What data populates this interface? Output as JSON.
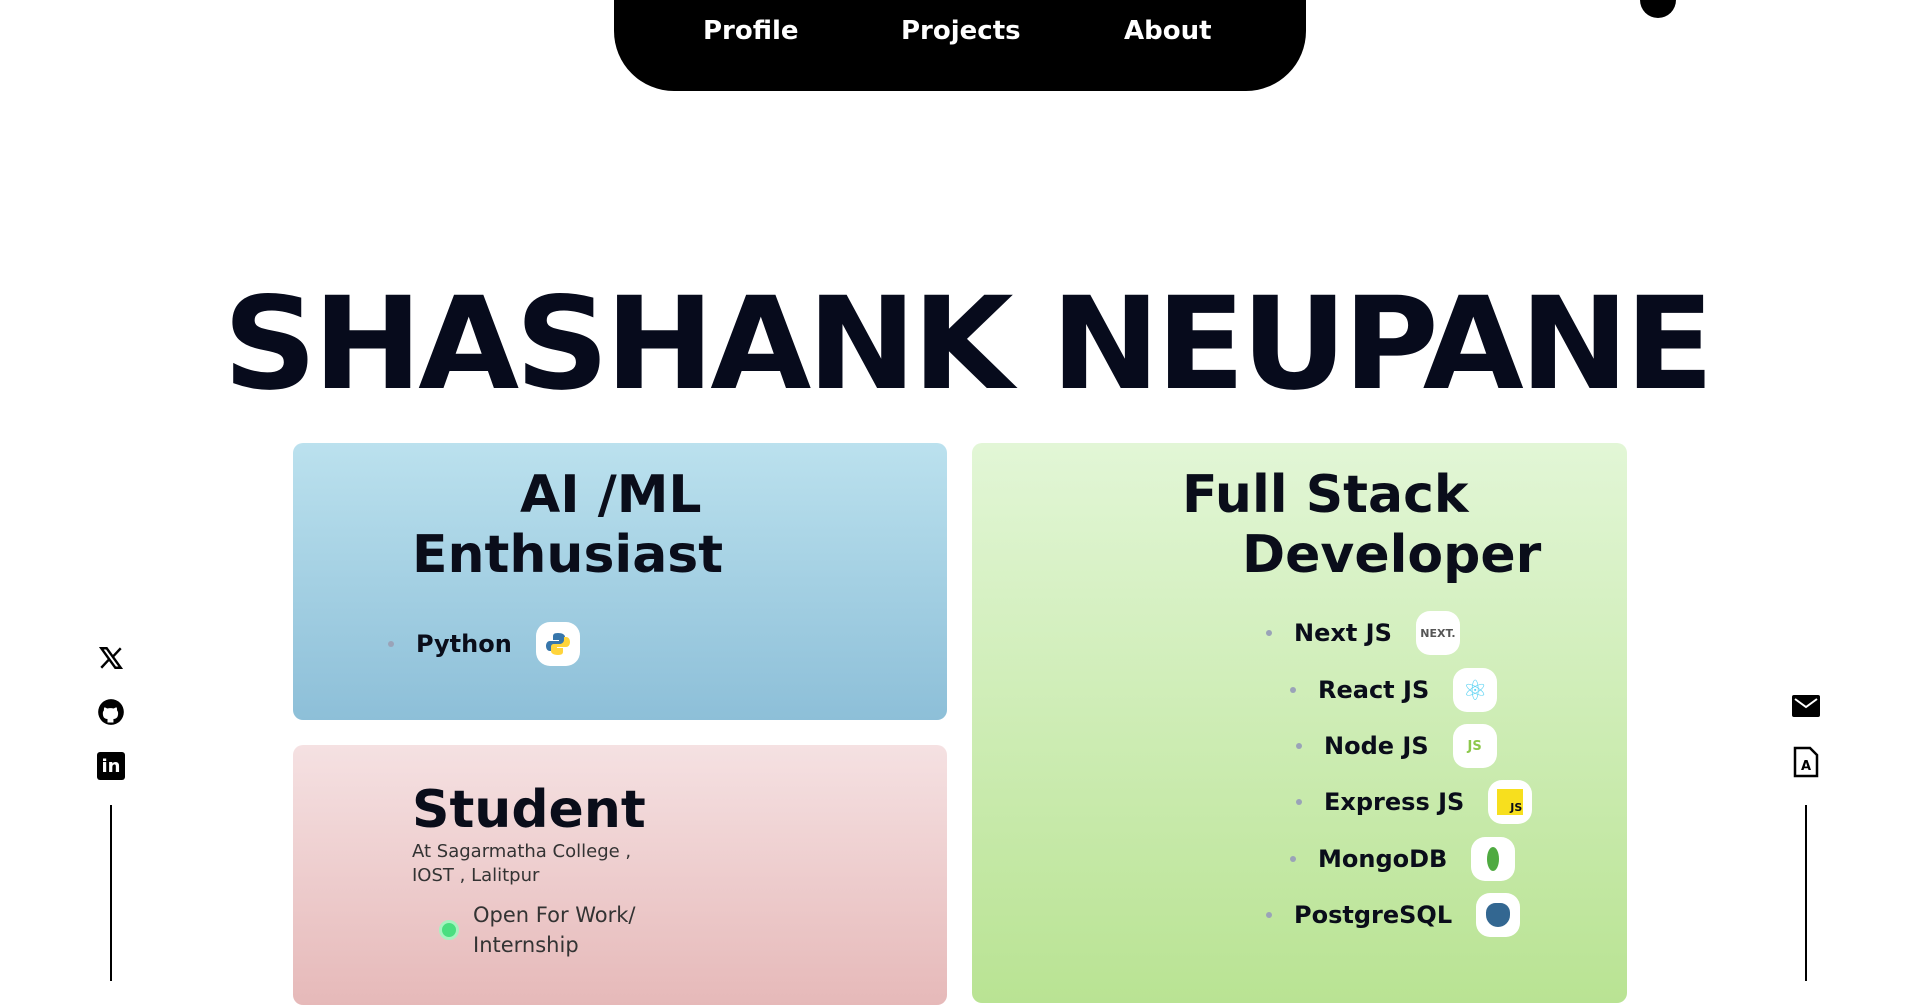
{
  "nav": {
    "items": [
      "Profile",
      "Projects",
      "About"
    ]
  },
  "hero": {
    "name": "SHASHANK NEUPANE"
  },
  "ai_card": {
    "title_line1": "AI /ML",
    "title_line2": "Enthusiast",
    "skills": [
      {
        "label": "Python",
        "icon": "python-icon"
      }
    ]
  },
  "student_card": {
    "title": "Student",
    "subtitle_line1": "At Sagarmatha College ,",
    "subtitle_line2": "IOST , Lalitpur",
    "status_line1": "Open For Work/",
    "status_line2": "Internship",
    "status_color": "#4ade80"
  },
  "fullstack_card": {
    "title_line1": "Full Stack",
    "title_line2": "Developer",
    "skills": [
      {
        "label": "Next JS",
        "icon": "nextjs-icon",
        "icon_text": "NEXT."
      },
      {
        "label": "React JS",
        "icon": "react-icon",
        "icon_text": "⚛"
      },
      {
        "label": "Node JS",
        "icon": "nodejs-icon",
        "icon_text": "JS"
      },
      {
        "label": "Express JS",
        "icon": "javascript-icon",
        "icon_text": "JS"
      },
      {
        "label": "MongoDB",
        "icon": "mongodb-leaf-icon",
        "icon_text": ""
      },
      {
        "label": "PostgreSQL",
        "icon": "postgresql-elephant-icon",
        "icon_text": ""
      }
    ]
  },
  "social": {
    "left": [
      "x-twitter-icon",
      "github-icon",
      "linkedin-icon"
    ],
    "right": [
      "mail-icon",
      "resume-icon"
    ],
    "linkedin_text": "in"
  }
}
